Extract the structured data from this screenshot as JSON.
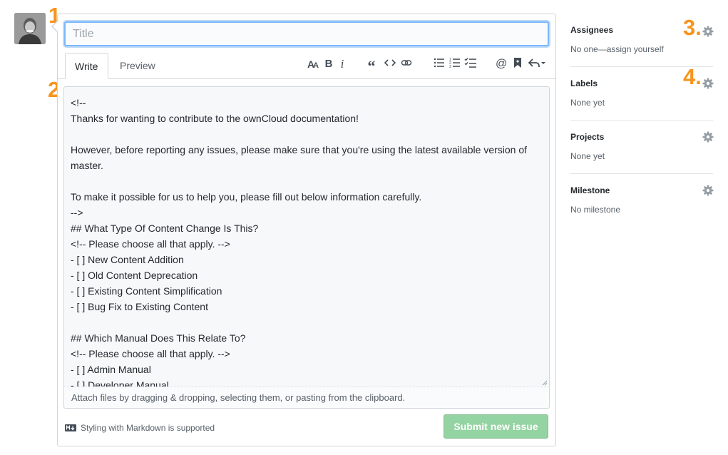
{
  "annotations": [
    "1.",
    "2.",
    "3.",
    "4."
  ],
  "issue_form": {
    "title_placeholder": "Title",
    "tabs": [
      {
        "label": "Write"
      },
      {
        "label": "Preview"
      }
    ],
    "toolbar_icons": [
      "text-size-icon",
      "bold-icon",
      "italic-icon",
      "quote-icon",
      "code-icon",
      "link-icon",
      "unordered-list-icon",
      "ordered-list-icon",
      "task-list-icon",
      "mention-icon",
      "saved-reply-icon",
      "reply-icon"
    ],
    "body_text": "<!--\nThanks for wanting to contribute to the ownCloud documentation!\n\nHowever, before reporting any issues, please make sure that you're using the latest available version of\nmaster.\n\nTo make it possible for us to help you, please fill out below information carefully.\n-->\n## What Type Of Content Change Is This?\n<!-- Please choose all that apply. -->\n- [ ] New Content Addition\n- [ ] Old Content Deprecation\n- [ ] Existing Content Simplification\n- [ ] Bug Fix to Existing Content\n\n## Which Manual Does This Relate To?\n<!-- Please choose all that apply. -->\n- [ ] Admin Manual\n- [ ] Developer Manual",
    "attach_hint": "Attach files by dragging & dropping, selecting them, or pasting from the clipboard.",
    "markdown_note": "Styling with Markdown is supported",
    "submit_label": "Submit new issue"
  },
  "sidebar": {
    "sections": [
      {
        "title": "Assignees",
        "value": "No one—assign yourself"
      },
      {
        "title": "Labels",
        "value": "None yet"
      },
      {
        "title": "Projects",
        "value": "None yet"
      },
      {
        "title": "Milestone",
        "value": "No milestone"
      }
    ]
  },
  "colors": {
    "annotation_orange": "#f7941d",
    "submit_disabled_green": "#94d3a2",
    "focus_blue": "#79b8ff"
  }
}
